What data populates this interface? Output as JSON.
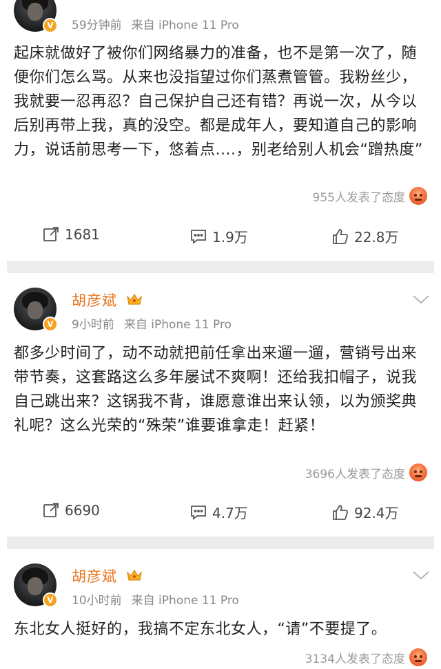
{
  "posts": [
    {
      "time": "59分钟前",
      "source": "来自 iPhone 11 Pro",
      "text": "起床就做好了被你们网络暴力的准备，也不是第一次了，随便你们怎么骂。从来也没指望过你们蒸煮管管。我粉丝少，我就要一忍再忍？自己保护自己还有错？再说一次，从今以后别再带上我，真的没空。都是成年人，要知道自己的影响力，说话前思考一下，悠着点....，别老给别人机会“蹭热度”",
      "reaction_count": "955人发表了态度",
      "repost": "1681",
      "comment": "1.9万",
      "like": "22.8万"
    },
    {
      "username": "胡彦斌",
      "time": "9小时前",
      "source": "来自 iPhone 11 Pro",
      "text": "都多少时间了，动不动就把前任拿出来遛一遛，营销号出来带节奏，这套路这么多年屡试不爽啊！还给我扣帽子，说我自己跳出来？这锅我不背，谁愿意谁出来认领，以为颁奖典礼呢？这么光荣的“殊荣”谁要谁拿走！赶紧！",
      "reaction_count": "3696人发表了态度",
      "repost": "6690",
      "comment": "4.7万",
      "like": "92.4万"
    },
    {
      "username": "胡彦斌",
      "time": "10小时前",
      "source": "来自 iPhone 11 Pro",
      "text": "东北女人挺好的，我搞不定东北女人，“请”不要提了。",
      "reaction_count": "3134人发表了态度"
    }
  ],
  "colors": {
    "username": "#e9741e",
    "badge": "#f6a21e",
    "separator": "#ececec"
  },
  "icons": [
    "verified-badge-icon",
    "crown-icon",
    "chevron-down-icon",
    "repost-icon",
    "comment-icon",
    "like-icon",
    "angry-emoji-icon"
  ]
}
